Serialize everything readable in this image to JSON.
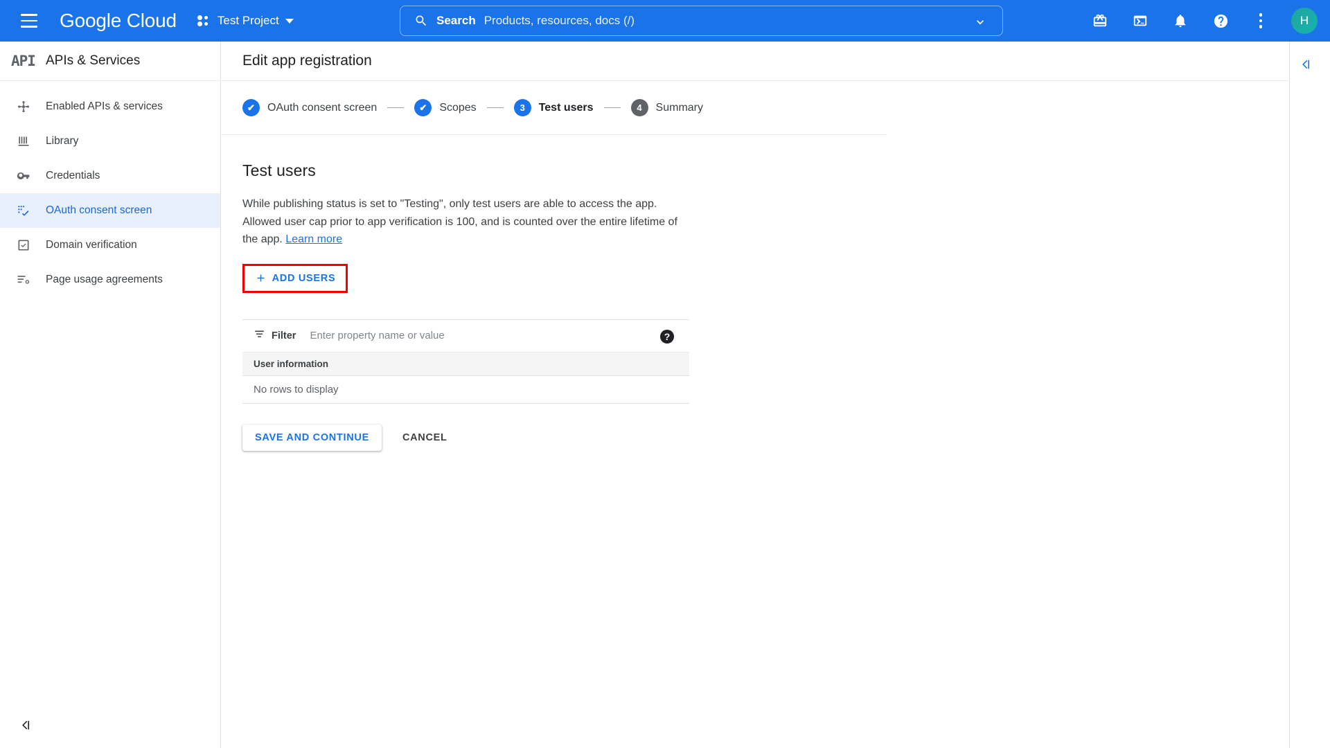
{
  "topbar": {
    "menu_icon": "hamburger-icon",
    "brand_part1": "Google",
    "brand_part2": "Cloud",
    "project_name": "Test Project",
    "project_icon": "project-dots-icon",
    "search": {
      "icon": "search-icon",
      "label": "Search",
      "placeholder": "Products, resources, docs (/)",
      "chevron": "chevron-down-icon"
    },
    "icons": [
      {
        "name": "gift-icon",
        "title": "Release notes"
      },
      {
        "name": "terminal-icon",
        "title": "Activate Cloud Shell"
      },
      {
        "name": "bell-icon",
        "title": "Notifications"
      },
      {
        "name": "help-icon",
        "title": "Support"
      },
      {
        "name": "more-vert-icon",
        "title": "More options"
      }
    ],
    "avatar_initial": "H"
  },
  "sidebar": {
    "logo_text": "API",
    "title": "APIs & Services",
    "items": [
      {
        "label": "Enabled APIs & services",
        "icon": "enabled-apis-icon",
        "active": false
      },
      {
        "label": "Library",
        "icon": "library-icon",
        "active": false
      },
      {
        "label": "Credentials",
        "icon": "key-icon",
        "active": false
      },
      {
        "label": "OAuth consent screen",
        "icon": "oauth-consent-icon",
        "active": true
      },
      {
        "label": "Domain verification",
        "icon": "domain-verification-icon",
        "active": false
      },
      {
        "label": "Page usage agreements",
        "icon": "page-usage-icon",
        "active": false
      }
    ],
    "collapse_icon": "collapse-left-icon"
  },
  "main": {
    "page_title": "Edit app registration",
    "stepper": [
      {
        "num": "1",
        "label": "OAuth consent screen",
        "state": "done",
        "glyph": "✔"
      },
      {
        "num": "2",
        "label": "Scopes",
        "state": "done",
        "glyph": "✔"
      },
      {
        "num": "3",
        "label": "Test users",
        "state": "current",
        "glyph": "3"
      },
      {
        "num": "4",
        "label": "Summary",
        "state": "pending",
        "glyph": "4"
      }
    ],
    "heading": "Test users",
    "description_text": "While publishing status is set to \"Testing\", only test users are able to access the app. Allowed user cap prior to app verification is 100, and is counted over the entire lifetime of the app. ",
    "learn_more": "Learn more",
    "add_users_button": "ADD USERS",
    "add_users_icon": "plus-icon",
    "highlight_color": "#f00000",
    "accent_color": "#1a73e8",
    "filter": {
      "icon": "filter-icon",
      "label": "Filter",
      "placeholder": "Enter property name or value",
      "help_icon": "help-circle-icon",
      "help_glyph": "?"
    },
    "table": {
      "columns": [
        "User information"
      ],
      "rows": [],
      "empty_message": "No rows to display"
    },
    "save_button": "SAVE AND CONTINUE",
    "cancel_button": "CANCEL"
  },
  "right_panel": {
    "collapse_icon": "collapse-left-icon"
  }
}
